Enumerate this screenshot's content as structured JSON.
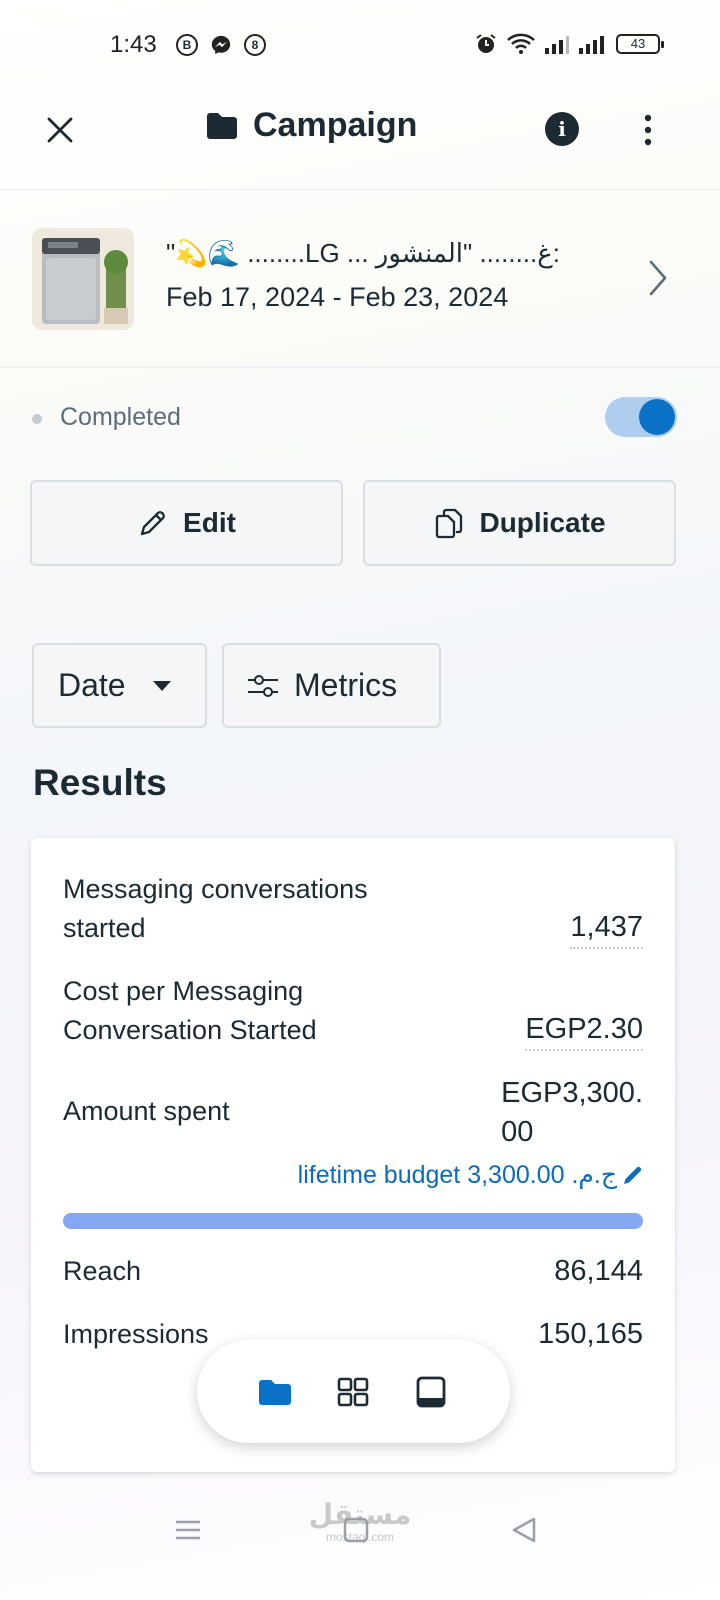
{
  "status_bar": {
    "time": "1:43",
    "notification_icons": [
      "B",
      "messenger",
      "8"
    ],
    "battery": "43"
  },
  "header": {
    "title": "Campaign",
    "close_icon": "close-icon",
    "folder_icon": "folder-icon",
    "info_icon": "info-icon",
    "more_icon": "more-vertical-icon"
  },
  "ad": {
    "title": "\"💫🌊 ........LG ... غ........ \"المنشور: ",
    "dates": "Feb 17, 2024 - Feb 23, 2024"
  },
  "status": {
    "label": "Completed",
    "toggle_on": true
  },
  "actions": {
    "edit_label": "Edit",
    "duplicate_label": "Duplicate"
  },
  "filters": {
    "date_label": "Date",
    "metrics_label": "Metrics"
  },
  "results": {
    "heading": "Results",
    "metrics": [
      {
        "label_line1": "Messaging conversations",
        "label_line2": "started",
        "value": "1,437"
      },
      {
        "label_line1": "Cost per Messaging",
        "label_line2": "Conversation Started",
        "value": "EGP2.30"
      },
      {
        "label": "Amount spent",
        "value_line1": "EGP3,300.",
        "value_line2": "00"
      },
      {
        "label": "Reach",
        "value": "86,144"
      },
      {
        "label": "Impressions",
        "value": "150,165"
      }
    ],
    "budget_text": "lifetime budget ج.م.‏ 3,300.00",
    "budget_progress": 1.0
  },
  "colors": {
    "accent": "#0a72c6",
    "budget_bar": "#86a8f2",
    "link": "#0a6bbf"
  },
  "watermark": {
    "arabic": "مستقل",
    "latin": "mostaql.com"
  }
}
